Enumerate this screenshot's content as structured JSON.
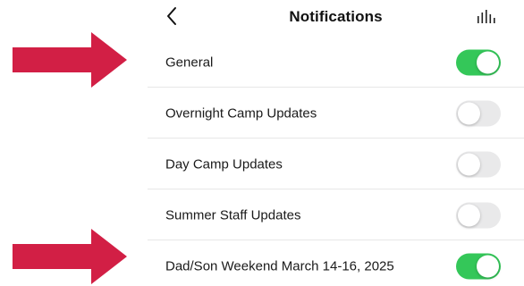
{
  "header": {
    "title": "Notifications",
    "back_icon": "chevron-left-icon",
    "right_icon": "bars-icon"
  },
  "colors": {
    "arrow": "#d21f45",
    "toggle_on": "#34c759",
    "toggle_off": "#e9e9ea"
  },
  "settings": [
    {
      "label": "General",
      "enabled": true
    },
    {
      "label": "Overnight Camp Updates",
      "enabled": false
    },
    {
      "label": "Day Camp Updates",
      "enabled": false
    },
    {
      "label": "Summer Staff Updates",
      "enabled": false
    },
    {
      "label": "Dad/Son Weekend March 14-16, 2025",
      "enabled": true
    }
  ]
}
